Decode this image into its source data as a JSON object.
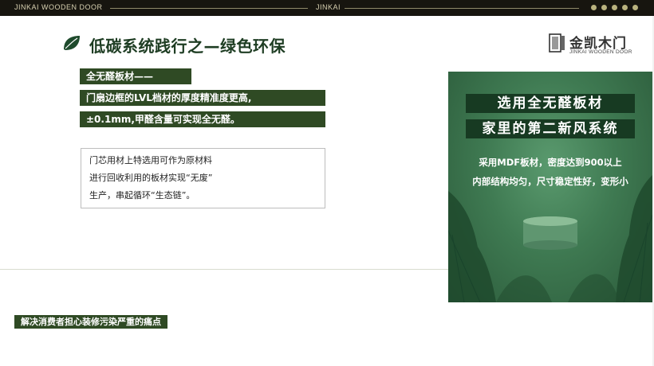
{
  "topbar": {
    "brand_left": "JINKAI WOODEN DOOR",
    "brand_center": "JINKAI",
    "dot_color": "#b9b27e",
    "background": "#17150f"
  },
  "title": {
    "text": "低碳系统践行之—绿色环保",
    "icon": "leaf-icon",
    "color": "#1e3d23"
  },
  "logo": {
    "cn": "金凯木门",
    "en": "JINKAI WOODEN DOOR"
  },
  "features": [
    "全无醛板材——",
    "门扇边框的LVL档材的厚度精准度更高,",
    "±0.1mm,甲醛含量可实现全无醛。"
  ],
  "note": {
    "lines": [
      "门芯用材上特选用可作为原材料",
      "进行回收利用的板材实现“无废”",
      "生产，串起循环“生态链”。"
    ]
  },
  "pain_point": "解决消费者担心装修污染严重的痛点",
  "panel": {
    "headline1": "选用全无醛板材",
    "headline2": "家里的第二新风系统",
    "desc1": "采用MDF板材，密度达到900以上",
    "desc2": "内部结构均匀，尺寸稳定性好，变形小",
    "accent": "#173a22"
  },
  "colors": {
    "brand_green": "#2f4a24"
  }
}
